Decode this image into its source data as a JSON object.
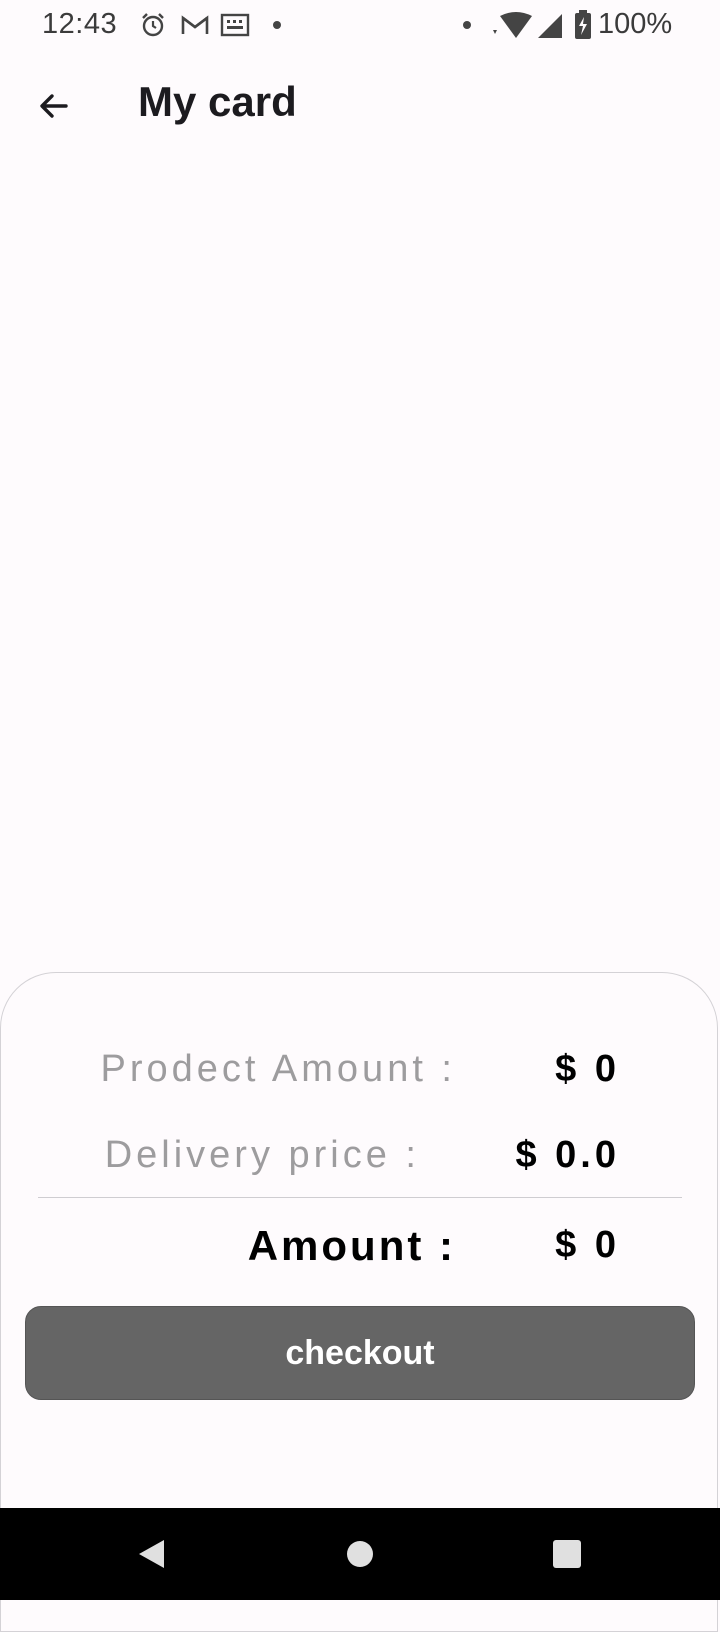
{
  "status_bar": {
    "time": "12:43",
    "battery": "100%",
    "icons": [
      "alarm-icon",
      "gmail-icon",
      "keyboard-icon",
      "dot-icon",
      "dot-icon",
      "wifi-icon",
      "cell-signal-icon",
      "battery-charging-icon"
    ]
  },
  "app_bar": {
    "title": "My card",
    "back_icon": "arrow-left-icon"
  },
  "summary": {
    "product_amount_label": "Prodect Amount :",
    "product_amount_value": "$ 0",
    "delivery_label": "Delivery price :",
    "delivery_value": "$ 0.0",
    "total_label": "Amount :",
    "total_value": "$ 0",
    "checkout_label": "checkout"
  },
  "nav_bar": {
    "back_icon": "nav-back-icon",
    "home_icon": "nav-home-icon",
    "recents_icon": "nav-recents-icon"
  },
  "colors": {
    "background": "#fefbfd",
    "checkout_button": "#656565",
    "label_grey": "#9d9c9e",
    "nav_bar": "#000000"
  }
}
